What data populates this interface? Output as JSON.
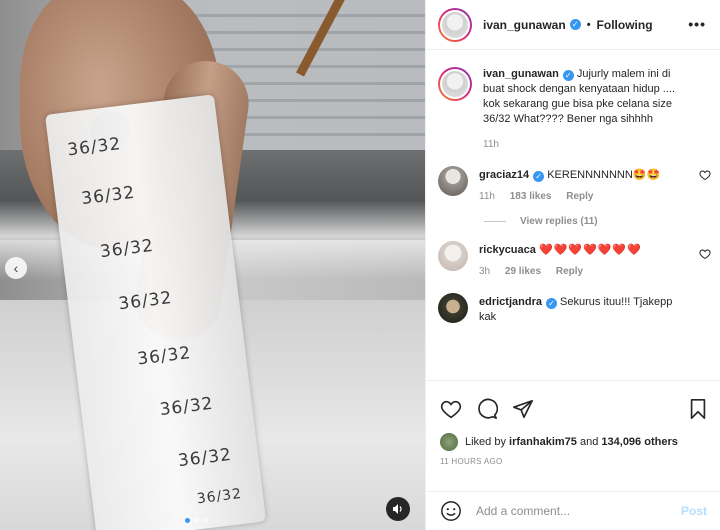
{
  "media": {
    "tape_labels": [
      "36/32",
      "36/32",
      "36/32",
      "36/32",
      "36/32",
      "36/32",
      "36/32",
      "36/32"
    ],
    "prev_arrow": "‹",
    "sound_icon": "speaker-icon"
  },
  "header": {
    "username": "ivan_gunawan",
    "separator": "•",
    "following": "Following",
    "more": "•••"
  },
  "caption": {
    "username": "ivan_gunawan",
    "text": "Jujurly malem ini di buat shock dengan kenyataan hidup .... kok sekarang gue bisa pke celana size 36/32 What???? Bener nga sihhhh",
    "time": "11h"
  },
  "comments": [
    {
      "username": "graciaz14",
      "text": "KERENNNNNNN🤩🤩",
      "time": "11h",
      "likes": "183 likes",
      "reply": "Reply",
      "verified": true,
      "view_replies": "View replies (11)"
    },
    {
      "username": "rickycuaca",
      "text": "❤️❤️❤️❤️❤️❤️❤️",
      "time": "3h",
      "likes": "29 likes",
      "reply": "Reply",
      "verified": false
    },
    {
      "username": "edrictjandra",
      "text": "Sekurus ituu!!! Tjakepp kak",
      "verified": true
    }
  ],
  "likes": {
    "prefix": "Liked by",
    "user": "irfanhakim75",
    "middle": "and",
    "count": "134,096 others"
  },
  "timestamp": "11 HOURS AGO",
  "add_comment": {
    "placeholder": "Add a comment...",
    "post": "Post"
  },
  "colors": {
    "accent": "#3897f0",
    "heart": "#ed4956",
    "muted": "#8e8e8e",
    "post_disabled": "#b2dffc"
  }
}
